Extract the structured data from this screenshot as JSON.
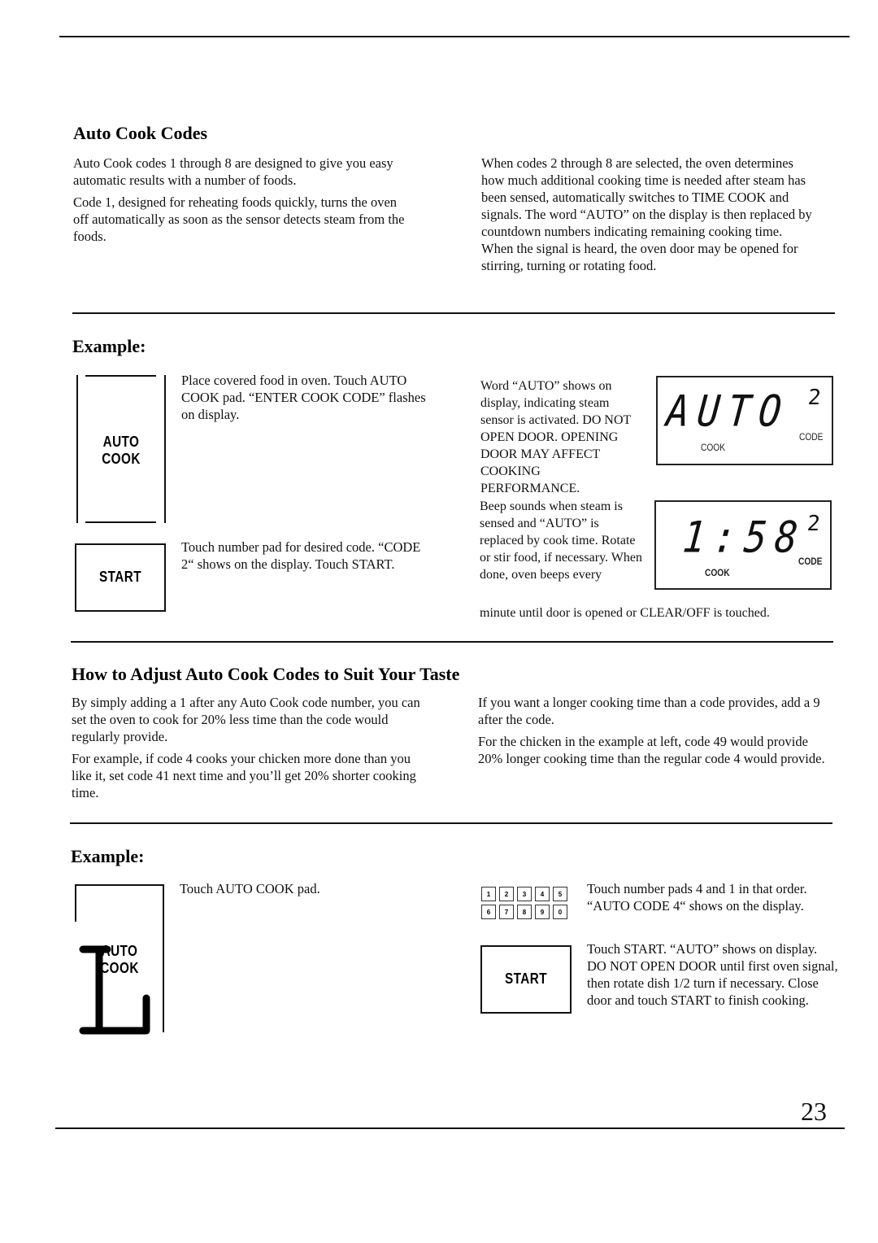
{
  "page": {
    "number": "23"
  },
  "auto_cook_codes": {
    "heading": "Auto Cook Codes",
    "left_paragraphs": [
      "Auto Cook codes 1 through 8 are designed to give you easy automatic results with a number of foods.",
      "Code 1, designed for reheating foods quickly, turns the oven off automatically as soon as the sensor detects steam from the foods."
    ],
    "right_paragraph": "When codes 2 through 8 are selected, the oven determines how much additional cooking time is needed after steam has been sensed, automatically switches to TIME COOK and signals. The word “AUTO” on the display is then replaced by countdown numbers indicating remaining cooking time. When the signal is heard, the oven door may be opened for stirring, turning or rotating food."
  },
  "example1": {
    "heading": "Example:",
    "auto_cook_pad": {
      "line1": "AUTO",
      "line2": "COOK"
    },
    "step1_text": "Place covered food in oven. Touch AUTO COOK pad. “ENTER COOK CODE” flashes on display.",
    "start_pad": {
      "label": "START"
    },
    "step2_text": "Touch number pad for desired code. “CODE 2“ shows on the display. Touch START.",
    "step3_text": "Word “AUTO” shows on display, indicating steam sensor is activated. DO NOT OPEN DOOR. OPENING DOOR MAY AFFECT COOKING PERFORMANCE.",
    "display1": {
      "main": "AUTO",
      "code_digit": "2",
      "cook_label": "COOK",
      "code_label": "CODE"
    },
    "step4_text_wrapped": "Beep sounds when steam is sensed and “AUTO” is replaced by cook time. Rotate or stir food, if necessary. When done, oven beeps every",
    "step4_text_tail": "minute until door is opened or CLEAR/OFF is touched.",
    "display2": {
      "main": "1:58",
      "code_digit": "2",
      "cook_label": "COOK",
      "code_label": "CODE"
    }
  },
  "adjust": {
    "heading": "How to Adjust Auto Cook Codes to Suit Your Taste",
    "left_paragraphs": [
      "By simply adding a 1 after any Auto Cook code number, you can set the oven to cook for 20% less time than the code would regularly provide.",
      "For example, if code 4 cooks your chicken more done than you like it, set code 41 next time and you’ll get 20% shorter cooking time."
    ],
    "right_paragraphs": [
      "If you want a longer cooking time than a code provides, add a 9 after the code.",
      "For the chicken in the example at left, code 49 would provide 20% longer cooking time than the regular code 4 would provide."
    ]
  },
  "example2": {
    "heading": "Example:",
    "auto_cook_pad": {
      "line1": "AUTO",
      "line2": "COOK"
    },
    "step1_text": "Touch AUTO COOK pad.",
    "number_keys": [
      "1",
      "2",
      "3",
      "4",
      "5",
      "6",
      "7",
      "8",
      "9",
      "0"
    ],
    "step2_text": "Touch number pads 4 and 1 in that order. “AUTO CODE 4“ shows on the display.",
    "start_pad": {
      "label": "START"
    },
    "step3_text": "Touch START. “AUTO” shows on display. DO NOT OPEN DOOR until first oven signal, then rotate dish 1/2 turn if necessary. Close door and touch START to finish cooking."
  }
}
